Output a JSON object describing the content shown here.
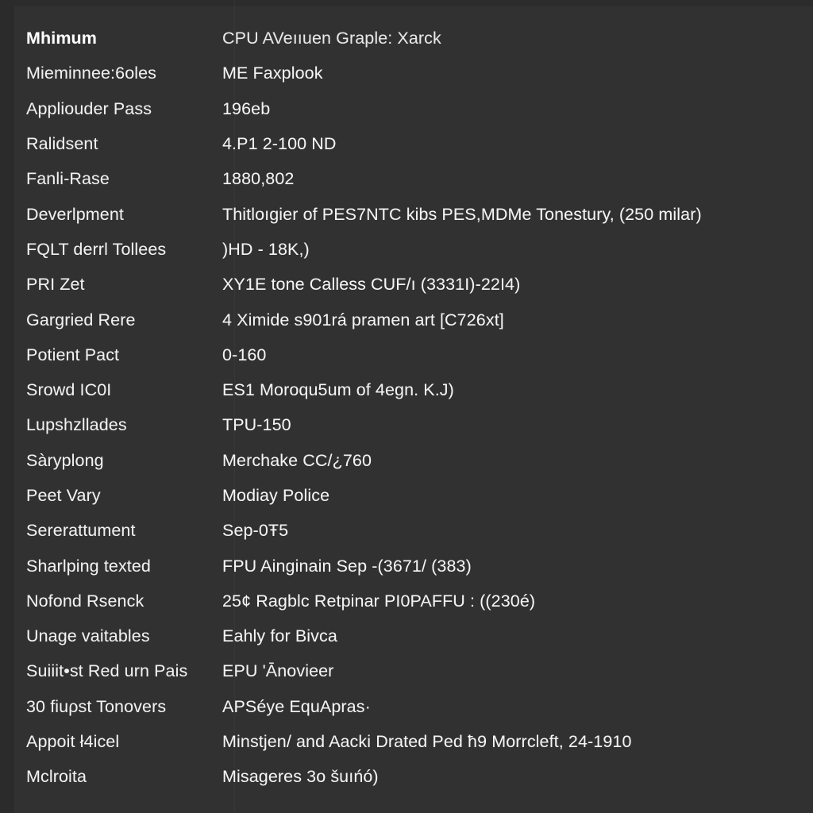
{
  "window": {
    "background_color": "#313131",
    "text_color": "#f1f1f1",
    "accent_edge_color": "#2b2b2b"
  },
  "table": {
    "column_headers": {
      "label_column": "Mhimum",
      "value_column": "CPU AVeııuen Graple: Xarck"
    },
    "rows": [
      {
        "label": "Mhimum",
        "value": "CPU AVeııuen Graple: Xarck",
        "header": true
      },
      {
        "label": "Mieminnee:6oles",
        "value": "ME Faxplook",
        "header": false
      },
      {
        "label": "Appliouder Pass",
        "value": "196eb",
        "header": false
      },
      {
        "label": "Ralidsent",
        "value": "4.P1 2-100 ND",
        "header": false
      },
      {
        "label": "Fanli-Rase",
        "value": "1880,802",
        "header": false
      },
      {
        "label": "Deverlpment",
        "value": "Thitloıgier of PES7NTC kibs PES,MDMe Tonestury, (250 milar)",
        "header": false
      },
      {
        "label": "FQLT derrl Tollees",
        "value": ")HD - 18K,)",
        "header": false
      },
      {
        "label": "PRI Zet",
        "value": "XY1E tone Calless CUF/ı (3331I)-22I4)",
        "header": false
      },
      {
        "label": "Gargried Rere",
        "value": "4 Ximide s901rá pramen art [C726xt]",
        "header": false
      },
      {
        "label": "Potient Pact",
        "value": "0-160",
        "header": false
      },
      {
        "label": "Srowd IC0I",
        "value": "ES1 Moroqu5um of 4egn. K.J)",
        "header": false
      },
      {
        "label": "Lupshzllades",
        "value": "TPU-150",
        "header": false
      },
      {
        "label": "Sàryplong",
        "value": "Merchake CC/¿760",
        "header": false
      },
      {
        "label": "Peet Vary",
        "value": "Modiay Police",
        "header": false
      },
      {
        "label": "Sererattument",
        "value": "Sep-0Ŧ5",
        "header": false
      },
      {
        "label": "Sharlping texted",
        "value": "FPU Ainginain Sep -(3671/ (383)",
        "header": false
      },
      {
        "label": "Nofond Rsenck",
        "value": "25¢ Ragblc Retpinar PI0PAFFU : ((230é)",
        "header": false
      },
      {
        "label": "Unage vaitables",
        "value": "Eahly for Bivca",
        "header": false
      },
      {
        "label": "Suiiit•st Red urn Pais",
        "value": "EPU 'Ānovieer",
        "header": false
      },
      {
        "label": "30 fiuρst Tonovers",
        "value": "APSéye EquApras·",
        "header": false
      },
      {
        "label": "Appoit ł4icel",
        "value": "Minstjen/ and Aacki Drated Ped ħ9 Morrcleft, 24-1910",
        "header": false
      },
      {
        "label": "Mclroita",
        "value": "Misageres 3o šuıńó)",
        "header": false
      }
    ]
  }
}
